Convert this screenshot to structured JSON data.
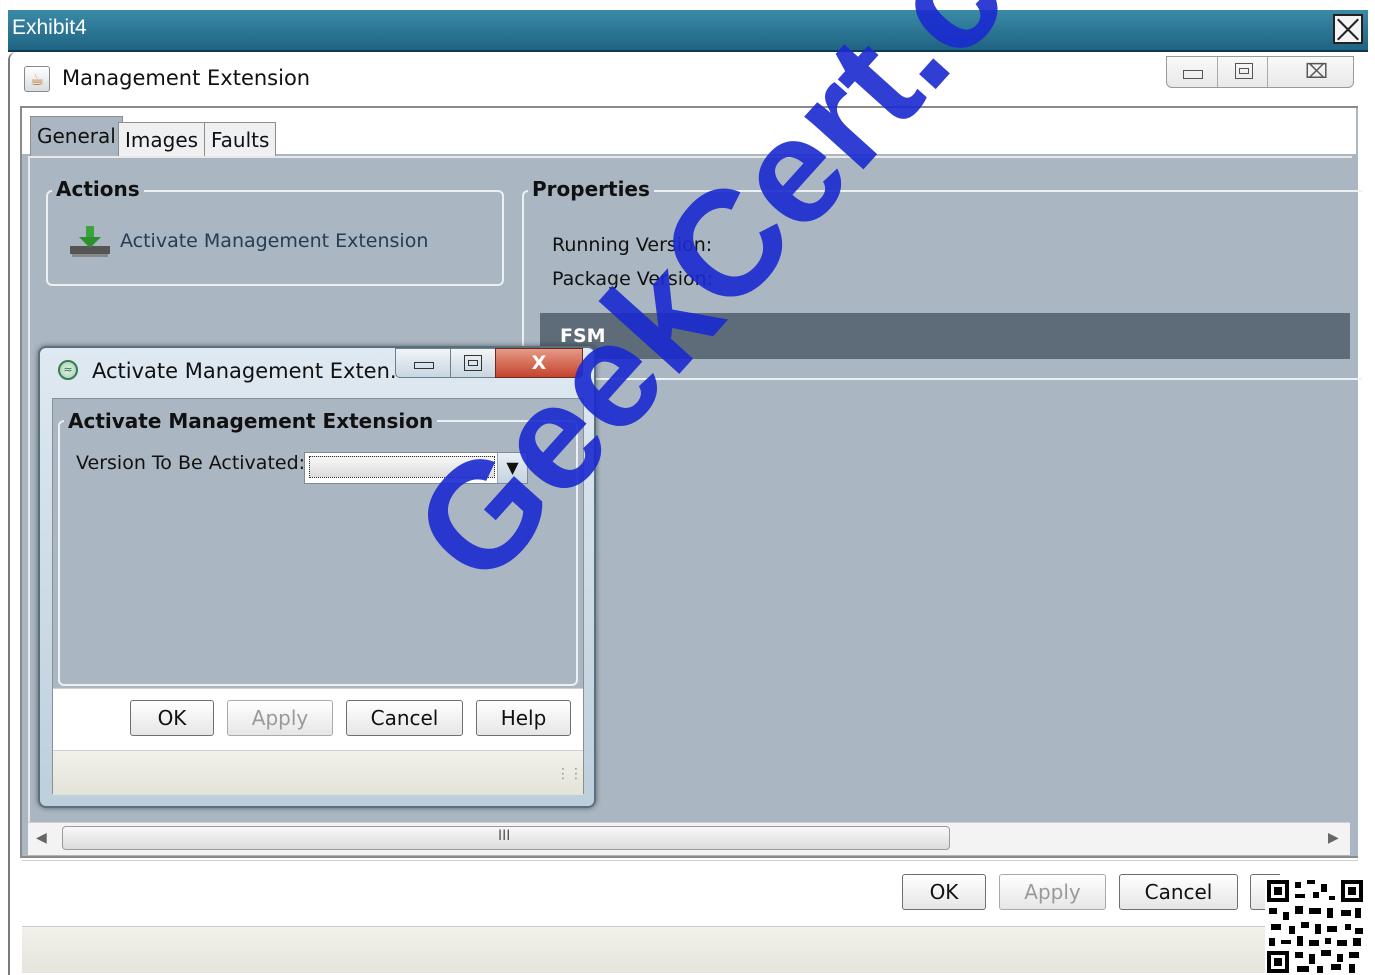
{
  "exhibit": {
    "title": "Exhibit4"
  },
  "main_window": {
    "title": "Management Extension",
    "tabs": [
      {
        "label": "General",
        "active": true
      },
      {
        "label": "Images"
      },
      {
        "label": "Faults"
      }
    ],
    "actions": {
      "title": "Actions",
      "items": [
        {
          "label": "Activate Management Extension",
          "icon": "download-to-server-icon"
        }
      ]
    },
    "properties": {
      "title": "Properties",
      "running_version_label": "Running Version:",
      "package_version_label": "Package Version:",
      "fsm_label": "FSM"
    },
    "scrollbar_grip": "III",
    "buttons": {
      "ok": "OK",
      "apply": "Apply",
      "cancel": "Cancel"
    }
  },
  "dialog": {
    "title": "Activate Management Exten...",
    "close_glyph": "X",
    "group_title": "Activate Management Extension",
    "version_label": "Version To Be Activated:",
    "version_value": "",
    "buttons": {
      "ok": "OK",
      "apply": "Apply",
      "cancel": "Cancel",
      "help": "Help"
    }
  },
  "watermark": "GeekCert.com",
  "colors": {
    "exhibit_bar": "#2a7596",
    "panel_bg": "#aab6c1",
    "fsm_bar": "#5d6c78",
    "dialog_close": "#c5432d",
    "watermark": "#1a2ad0"
  }
}
